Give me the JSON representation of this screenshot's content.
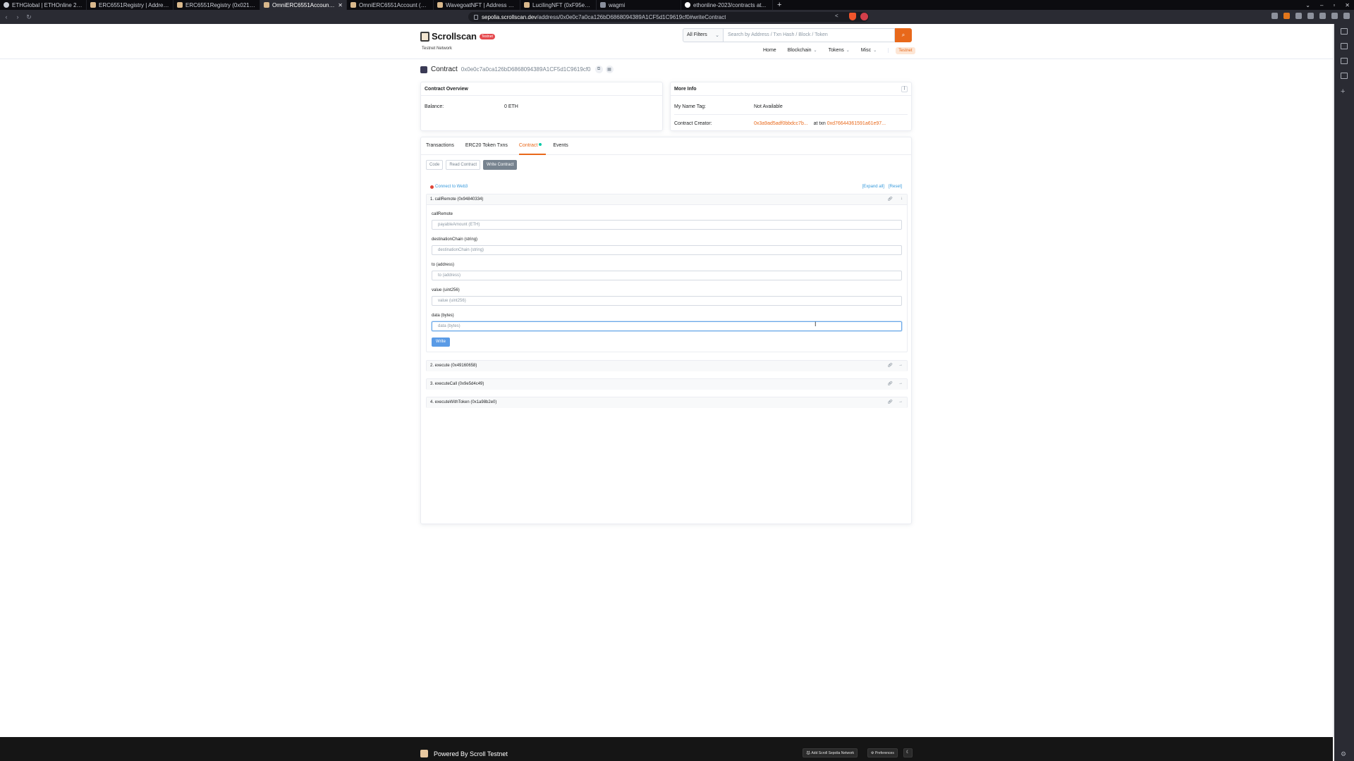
{
  "browser": {
    "tabs": [
      {
        "label": "ETHGlobal | ETHOnline 2023",
        "icon": "eth-icon",
        "active": false
      },
      {
        "label": "ERC6551Registry | Address 0x...",
        "icon": "scroll-icon",
        "active": false
      },
      {
        "label": "ERC6551Registry (0x02101C9...",
        "icon": "scroll-icon",
        "active": false
      },
      {
        "label": "OmniERC6551Account | A...",
        "icon": "scroll-icon",
        "active": true
      },
      {
        "label": "OmniERC6551Account (0x0e...",
        "icon": "scroll-icon",
        "active": false
      },
      {
        "label": "WavegoatNFT | Address 0xff...",
        "icon": "scroll-icon",
        "active": false
      },
      {
        "label": "LucilingNFT (0xF95e44F3af2e...",
        "icon": "scroll-icon",
        "active": false
      },
      {
        "label": "wagmi",
        "icon": "globe-icon",
        "active": false
      },
      {
        "label": "ethonline-2023/contracts at...",
        "icon": "github-icon",
        "active": false
      }
    ],
    "new_tab": "+",
    "url_host": "sepolia.scrollscan.dev",
    "url_path": "/address/0x0e0c7a0ca126bD6868094389A1CF5d1C9619cf0#writeContract"
  },
  "header": {
    "logo_text": "Scrollscan",
    "badge": "Testnet",
    "network": "Testnet Network",
    "filter": "All Filters",
    "search_placeholder": "Search by Address / Txn Hash / Block / Token",
    "nav": [
      "Home",
      "Blockchain",
      "Tokens",
      "Misc"
    ],
    "nav_testnet": "Testnet"
  },
  "contract": {
    "label": "Contract",
    "address": "0x0e0c7a0ca126bD6868094389A1CF5d1C9619cf0"
  },
  "overview": {
    "title": "Contract Overview",
    "balance_label": "Balance:",
    "balance_value": "0 ETH"
  },
  "more_info": {
    "title": "More Info",
    "name_tag_label": "My Name Tag:",
    "name_tag_value": "Not Available",
    "creator_label": "Contract Creator:",
    "creator_address": "0x3a9ad5adf0bbdcc7b...",
    "creator_at": "at txn",
    "creator_txn": "0xd76644361591a61e97..."
  },
  "tabs": [
    "Transactions",
    "ERC20 Token Txns",
    "Contract",
    "Events"
  ],
  "sub_buttons": [
    "Code",
    "Read Contract",
    "Write Contract"
  ],
  "connect": "Connect to Web3",
  "expand_links": [
    "[Expand all]",
    "[Reset]"
  ],
  "functions": [
    {
      "title": "1. callRemote (0x94840334)"
    },
    {
      "title": "2. execute (0x49160658)"
    },
    {
      "title": "3. executeCall (0x9e5d4c49)"
    },
    {
      "title": "4. executeWithToken (0x1a98b2e0)"
    }
  ],
  "call_remote": {
    "heading": "callRemote",
    "fields": [
      {
        "label": "",
        "placeholder": "payableAmount (ETH)"
      },
      {
        "label": "destinationChain (string)",
        "placeholder": "destinationChain (string)"
      },
      {
        "label": "to (address)",
        "placeholder": "to (address)"
      },
      {
        "label": "value (uint256)",
        "placeholder": "value (uint256)"
      },
      {
        "label": "data (bytes)",
        "placeholder": "data (bytes)"
      }
    ],
    "write_label": "Write"
  },
  "footer": {
    "powered": "Powered By Scroll Testnet",
    "add_network": "Add Scroll Sepolia Network",
    "preferences": "Preferences"
  }
}
